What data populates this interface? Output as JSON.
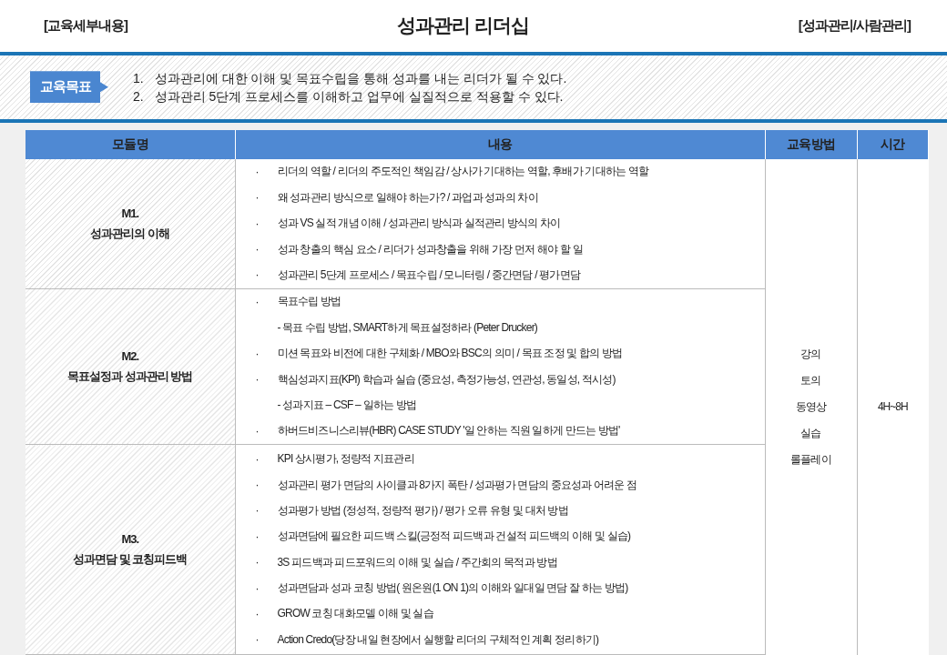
{
  "header": {
    "category": "[교육세부내용]",
    "title": "성과관리 리더십",
    "tag": "[성과관리/사람관리]"
  },
  "objectives": {
    "label": "교육목표",
    "items": [
      {
        "number": "1.",
        "text": "성과관리에 대한 이해 및 목표수립을 통해 성과를 내는 리더가 될 수 있다."
      },
      {
        "number": "2.",
        "text": "성과관리 5단계 프로세스를 이해하고 업무에 실질적으로 적용할 수 있다."
      }
    ]
  },
  "table": {
    "columns": [
      "모듈명",
      "내용",
      "교육방법",
      "시간"
    ],
    "methods": [
      "강의",
      "토의",
      "동영상",
      "실습",
      "롤플레이"
    ],
    "time": "4H~8H",
    "rows": [
      {
        "code": "M1.",
        "name": "성과관리의 이해",
        "items": [
          {
            "kind": "bullet",
            "bullet": "·",
            "text": "리더의 역할 / 리더의 주도적인 책임감 / 상사가 기대하는 역할, 후배가 기대하는 역할"
          },
          {
            "kind": "bullet",
            "bullet": "·",
            "text": "왜 성과관리 방식으로 일해야 하는가? / 과업과 성과의 차이"
          },
          {
            "kind": "bullet",
            "bullet": "·",
            "text": " 성과 VS 실적 개념 이해 / 성과관리 방식과 실적관리 방식의 차이"
          },
          {
            "kind": "bullet",
            "bullet": "·",
            "text": "성과 창출의 핵심 요소 / 리더가 성과창출을 위해 가장 먼저 해야 할 일"
          },
          {
            "kind": "bullet",
            "bullet": "·",
            "text": "성과관리 5단계 프로세스 / 목표수립 / 모니터링 / 중간면담 / 평가면담"
          }
        ]
      },
      {
        "code": "M2.",
        "name": "목표설정과 성과관리 방법",
        "items": [
          {
            "kind": "bullet",
            "bullet": "·",
            "text": "목표수립 방법"
          },
          {
            "kind": "sub",
            "text": "- 목표 수립 방법, SMART하게 목표설정하라 (Peter Drucker)"
          },
          {
            "kind": "bullet",
            "bullet": "·",
            "text": "미션 목표와 비전에 대한 구체화  /  MBO와 BSC의 의미  / 목표 조정 및 합의 방법"
          },
          {
            "kind": "bullet",
            "bullet": "·",
            "text": "핵심성과지표(KPI) 학습과 실습  (중요성, 측정가능성, 연관성, 동일성, 적시성)"
          },
          {
            "kind": "sub",
            "text": " - 성과지표 – CSF – 일하는 방법"
          },
          {
            "kind": "bullet",
            "bullet": "·",
            "text": "하버드비즈니스리뷰(HBR) CASE STUDY  '일 안하는 직원 일하게 만드는 방법'"
          }
        ]
      },
      {
        "code": "M3.",
        "name": "성과면담 및 코칭피드백",
        "items": [
          {
            "kind": "bullet",
            "bullet": "·",
            "text": " KPI 상시평가, 정량적 지표관리"
          },
          {
            "kind": "bullet",
            "bullet": "·",
            "text": "성과관리 평가 면담의 사이클과 8가지 폭탄 / 성과평가 면담의 중요성과 어려운 점"
          },
          {
            "kind": "bullet",
            "bullet": "·",
            "text": "성과평가 방법 (정성적, 정량적 평가) / 평가 오류 유형 및 대처 방법"
          },
          {
            "kind": "bullet",
            "bullet": "·",
            "text": "성과면담에 필요한 피드백 스킬(긍정적 피드백과 건설적 피드백의 이해 및 실습)"
          },
          {
            "kind": "bullet",
            "bullet": "·",
            "text": "3S 피드백과 피드포워드의 이해 및 실습 / 주간회의 목적과 방법"
          },
          {
            "kind": "bullet",
            "bullet": "·",
            "text": "성과면담과 성과 코칭 방법( 원온원(1 ON 1)의 이해와 일대일 면담 잘 하는 방법)"
          },
          {
            "kind": "bullet",
            "bullet": "·",
            "text": "GROW 코칭 대화모델 이해 및 실습"
          },
          {
            "kind": "bullet",
            "bullet": "·",
            "text": "Action Credo(당장 내일 현장에서 실행할 리더의 구체적인 계획 정리하기)"
          }
        ]
      }
    ]
  }
}
